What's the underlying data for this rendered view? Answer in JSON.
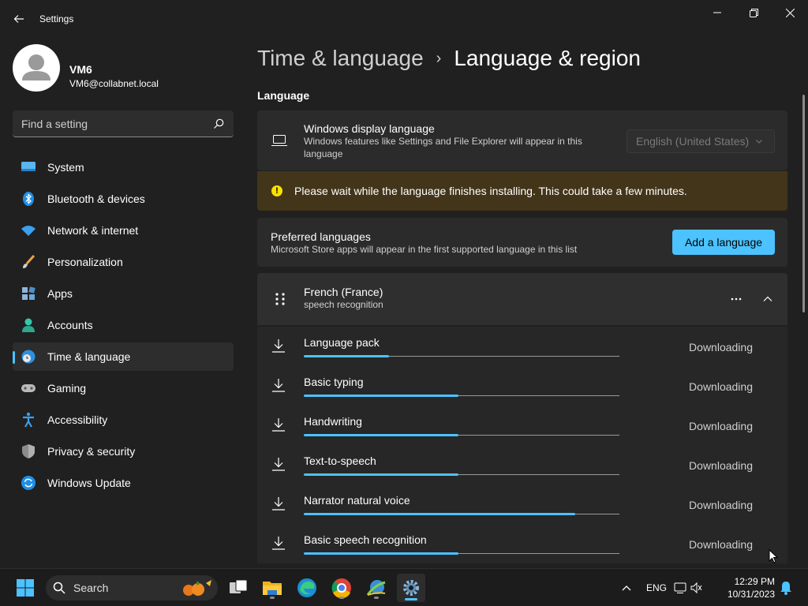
{
  "window": {
    "app_title": "Settings"
  },
  "profile": {
    "name": "VM6",
    "email": "VM6@collabnet.local"
  },
  "search": {
    "placeholder": "Find a setting"
  },
  "sidebar": {
    "items": [
      {
        "label": "System",
        "icon": "system-icon",
        "active": false
      },
      {
        "label": "Bluetooth & devices",
        "icon": "bluetooth-icon",
        "active": false
      },
      {
        "label": "Network & internet",
        "icon": "wifi-icon",
        "active": false
      },
      {
        "label": "Personalization",
        "icon": "brush-icon",
        "active": false
      },
      {
        "label": "Apps",
        "icon": "apps-icon",
        "active": false
      },
      {
        "label": "Accounts",
        "icon": "accounts-icon",
        "active": false
      },
      {
        "label": "Time & language",
        "icon": "globe-clock-icon",
        "active": true
      },
      {
        "label": "Gaming",
        "icon": "gamepad-icon",
        "active": false
      },
      {
        "label": "Accessibility",
        "icon": "accessibility-icon",
        "active": false
      },
      {
        "label": "Privacy & security",
        "icon": "shield-icon",
        "active": false
      },
      {
        "label": "Windows Update",
        "icon": "update-icon",
        "active": false
      }
    ]
  },
  "breadcrumb": {
    "parent": "Time & language",
    "separator": "›",
    "current": "Language & region"
  },
  "language_section": {
    "title": "Language",
    "display_language": {
      "title": "Windows display language",
      "description": "Windows features like Settings and File Explorer will appear in this language",
      "selected": "English (United States)"
    },
    "warning": "Please wait while the language finishes installing. This could take a few minutes.",
    "preferred": {
      "title": "Preferred languages",
      "description": "Microsoft Store apps will appear in the first supported language in this list",
      "add_button": "Add a language"
    },
    "french": {
      "name": "French (France)",
      "subtitle": "speech recognition"
    },
    "downloads": [
      {
        "label": "Language pack",
        "status": "Downloading",
        "progress": 0.27
      },
      {
        "label": "Basic typing",
        "status": "Downloading",
        "progress": 0.49
      },
      {
        "label": "Handwriting",
        "status": "Downloading",
        "progress": 0.49
      },
      {
        "label": "Text-to-speech",
        "status": "Downloading",
        "progress": 0.49
      },
      {
        "label": "Narrator natural voice",
        "status": "Downloading",
        "progress": 0.86
      },
      {
        "label": "Basic speech recognition",
        "status": "Downloading",
        "progress": 0.49
      }
    ]
  },
  "taskbar": {
    "search_label": "Search",
    "language": "ENG",
    "time": "12:29 PM",
    "date": "10/31/2023"
  },
  "colors": {
    "accent": "#4cc2ff",
    "warning_bg": "#433519",
    "warning_icon": "#fce100"
  }
}
